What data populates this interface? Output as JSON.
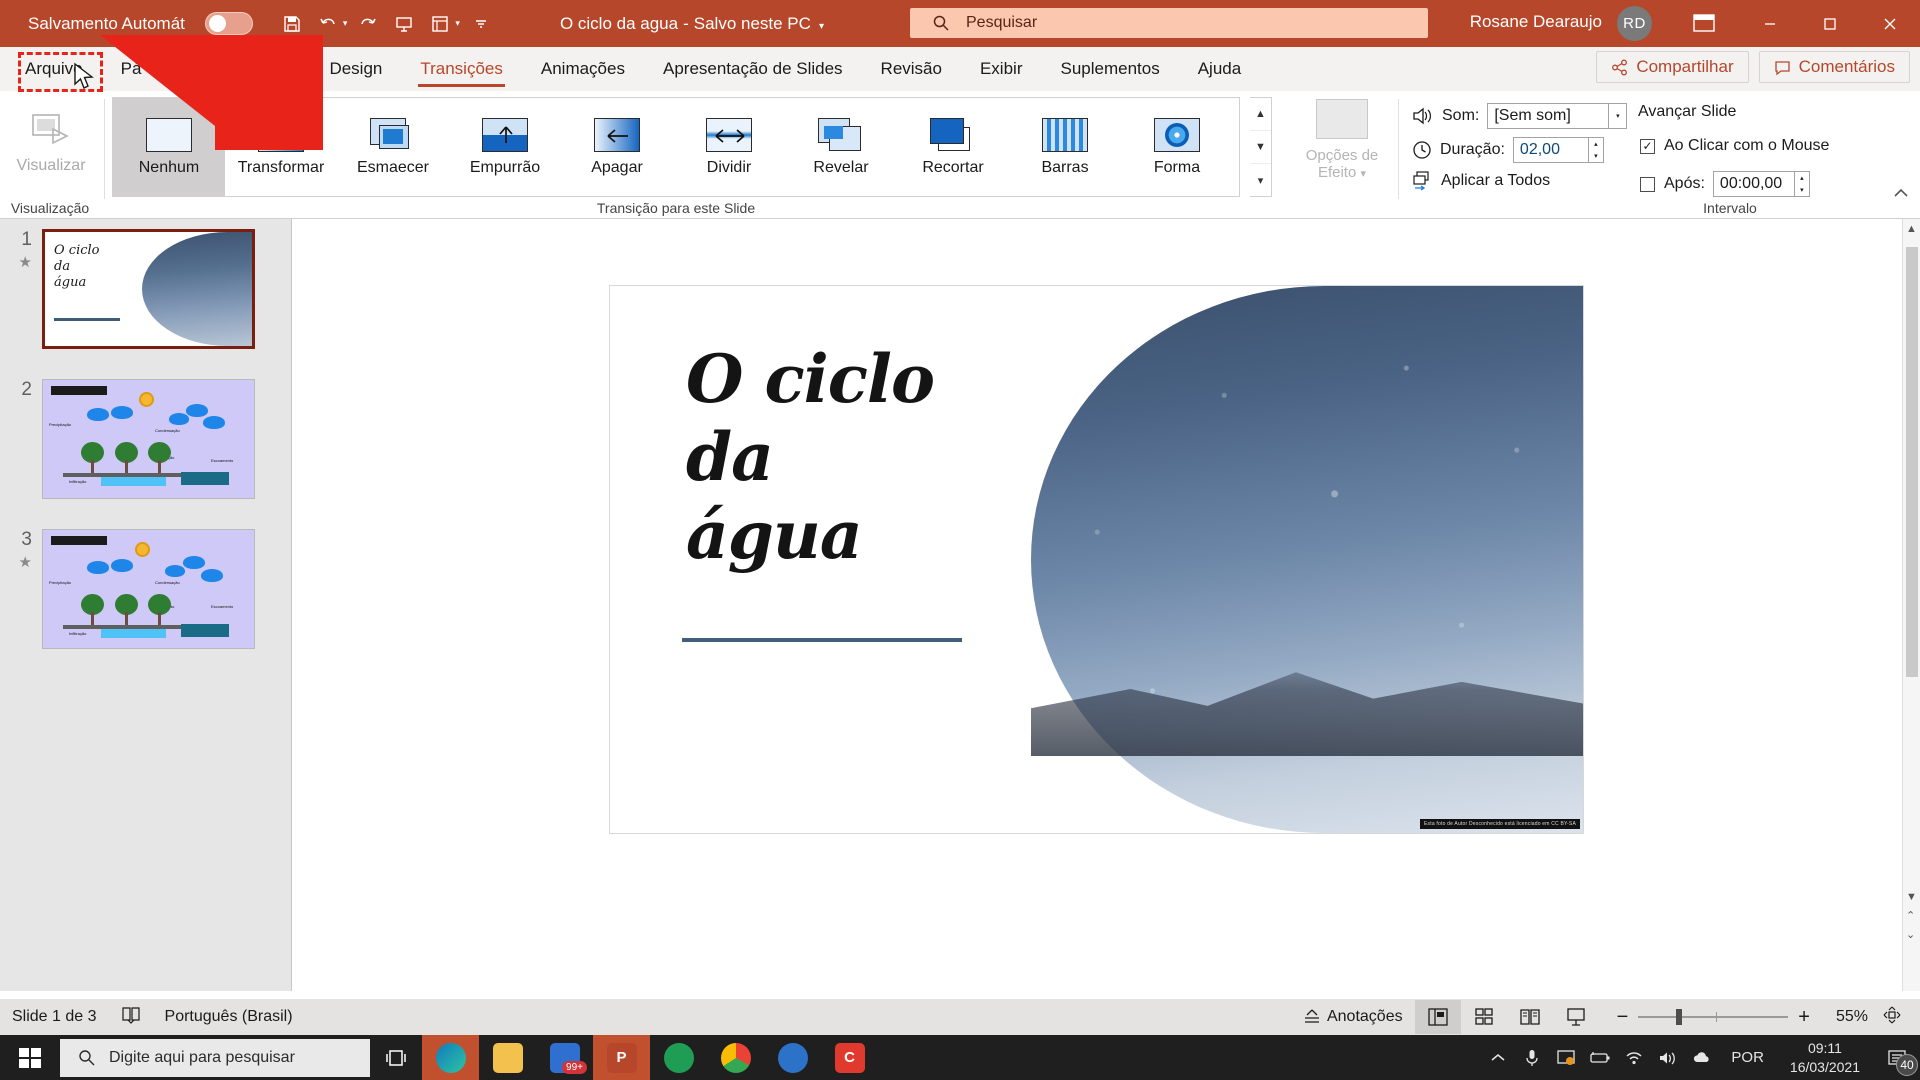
{
  "titlebar": {
    "autosave_label": "Salvamento Automát",
    "autosave_state": "off",
    "quick_access": [
      {
        "name": "save-icon",
        "glyph": "ὋE"
      },
      {
        "name": "undo-icon"
      },
      {
        "name": "redo-icon"
      },
      {
        "name": "start-presentation-icon"
      },
      {
        "name": "new-slide-icon"
      },
      {
        "name": "customize-qat-icon"
      }
    ],
    "document_title": "O ciclo da agua",
    "document_status": "Salvo neste PC",
    "search_placeholder": "Pesquisar",
    "user_name": "Rosane Dearaujo",
    "user_initials": "RD",
    "accent_color": "#b7472a",
    "window_controls": [
      "minimize",
      "maximize",
      "close"
    ]
  },
  "tabs": [
    {
      "label": "Arquivo",
      "active": false
    },
    {
      "label": "Pá",
      "active": false
    },
    {
      "label": "Design",
      "active": false
    },
    {
      "label": "Transições",
      "active": true
    },
    {
      "label": "Animações",
      "active": false
    },
    {
      "label": "Apresentação de Slides",
      "active": false
    },
    {
      "label": "Revisão",
      "active": false
    },
    {
      "label": "Exibir",
      "active": false
    },
    {
      "label": "Suplementos",
      "active": false
    },
    {
      "label": "Ajuda",
      "active": false
    }
  ],
  "tabbar_right": {
    "share_label": "Compartilhar",
    "comments_label": "Comentários"
  },
  "ribbon": {
    "preview": {
      "button_label": "Visualizar",
      "group_label": "Visualização"
    },
    "transitions": {
      "group_label": "Transição para este Slide",
      "items": [
        {
          "label": "Nenhum",
          "selected": true,
          "icon": "none-transition-icon"
        },
        {
          "label": "Transformar",
          "selected": false,
          "icon": "morph-transition-icon"
        },
        {
          "label": "Esmaecer",
          "selected": false,
          "icon": "fade-transition-icon"
        },
        {
          "label": "Empurrão",
          "selected": false,
          "icon": "push-transition-icon"
        },
        {
          "label": "Apagar",
          "selected": false,
          "icon": "wipe-transition-icon"
        },
        {
          "label": "Dividir",
          "selected": false,
          "icon": "split-transition-icon"
        },
        {
          "label": "Revelar",
          "selected": false,
          "icon": "reveal-transition-icon"
        },
        {
          "label": "Recortar",
          "selected": false,
          "icon": "cut-transition-icon"
        },
        {
          "label": "Barras",
          "selected": false,
          "icon": "bars-transition-icon"
        },
        {
          "label": "Forma",
          "selected": false,
          "icon": "shape-transition-icon"
        }
      ]
    },
    "effect_options": {
      "label_line1": "Opções de",
      "label_line2": "Efeito",
      "enabled": false
    },
    "timing": {
      "group_label": "Intervalo",
      "sound_label": "Som:",
      "sound_value": "[Sem som]",
      "duration_label": "Duração:",
      "duration_value": "02,00",
      "apply_all_label": "Aplicar a Todos",
      "advance_slide_label": "Avançar Slide",
      "on_click_label": "Ao Clicar com o Mouse",
      "on_click_checked": true,
      "after_label": "Após:",
      "after_checked": false,
      "after_value": "00:00,00"
    }
  },
  "thumbnails": [
    {
      "number": "1",
      "selected": true,
      "has_star": true,
      "kind": "title-slide",
      "title_lines": [
        "O ciclo",
        "da",
        "água"
      ]
    },
    {
      "number": "2",
      "selected": false,
      "has_star": false,
      "kind": "water-cycle",
      "labels": [
        "Precipitação",
        "Condensação",
        "Evaporação",
        "Escoamento",
        "Infiltração"
      ]
    },
    {
      "number": "3",
      "selected": false,
      "has_star": true,
      "kind": "water-cycle",
      "labels": [
        "Precipitação",
        "Condensação",
        "Evaporação",
        "Escoamento",
        "Infiltração"
      ]
    }
  ],
  "slide": {
    "title_lines": [
      "O ciclo",
      "da",
      "água"
    ],
    "image_credit": "Esta foto de Autor Desconhecido está licenciado em CC BY-SA"
  },
  "statusbar": {
    "slide_count_label": "Slide 1 de 3",
    "language": "Português (Brasil)",
    "notes_label": "Anotações",
    "views": [
      {
        "name": "normal-view",
        "active": true
      },
      {
        "name": "slide-sorter-view",
        "active": false
      },
      {
        "name": "reading-view",
        "active": false
      },
      {
        "name": "slideshow-view",
        "active": false
      }
    ],
    "zoom_out": "−",
    "zoom_in": "+",
    "zoom_level": "55%",
    "fit_label": "fit-to-window"
  },
  "taskbar": {
    "search_placeholder": "Digite aqui para pesquisar",
    "apps": [
      {
        "name": "edge-app",
        "letter": "e",
        "color": "#1a7ab5",
        "badge": null
      },
      {
        "name": "file-explorer-app",
        "letter": "",
        "color": "#f5c542",
        "badge": null
      },
      {
        "name": "mail-app",
        "letter": "",
        "color": "#2f6fd0",
        "badge": "99+"
      },
      {
        "name": "powerpoint-app",
        "letter": "P",
        "color": "#c1502e",
        "badge": null
      },
      {
        "name": "whatsapp-app",
        "letter": "",
        "color": "#25d366",
        "badge": null
      },
      {
        "name": "chrome-app",
        "letter": "",
        "color": "#4285f4",
        "badge": null
      },
      {
        "name": "browser-app",
        "letter": "",
        "color": "#2d72c9",
        "badge": null
      },
      {
        "name": "camtasia-app",
        "letter": "C",
        "color": "#e03a2f",
        "badge": null
      }
    ],
    "tray": {
      "language": "POR",
      "time": "09:11",
      "date": "16/03/2021",
      "notification_count": "40"
    }
  }
}
